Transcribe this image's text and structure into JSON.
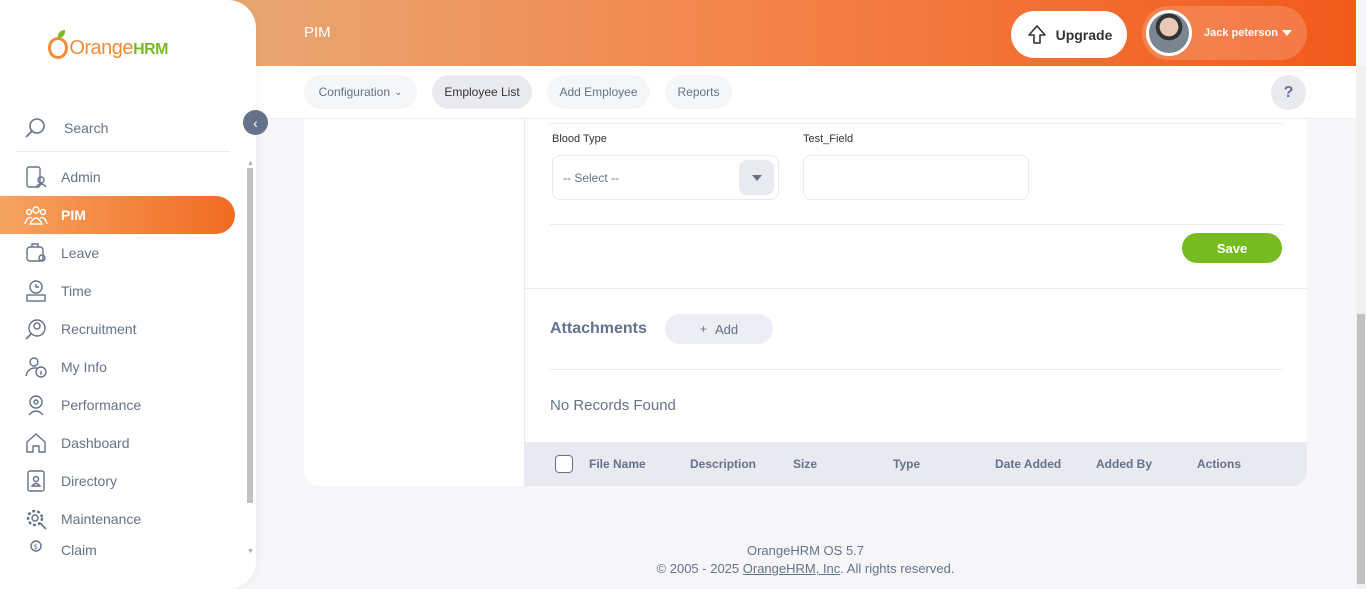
{
  "brand": {
    "name_main": "Orange",
    "name_suffix": "HRM"
  },
  "header": {
    "module_title": "PIM",
    "upgrade_label": "Upgrade",
    "user_name": "Jack peterson"
  },
  "subnav": {
    "tabs": [
      {
        "label": "Configuration",
        "has_dropdown": true
      },
      {
        "label": "Employee List",
        "active": true
      },
      {
        "label": "Add Employee"
      },
      {
        "label": "Reports"
      }
    ],
    "help_label": "?"
  },
  "sidebar": {
    "search_label": "Search",
    "items": [
      {
        "label": "Admin",
        "icon": "admin-icon"
      },
      {
        "label": "PIM",
        "icon": "pim-icon",
        "active": true
      },
      {
        "label": "Leave",
        "icon": "leave-icon"
      },
      {
        "label": "Time",
        "icon": "time-icon"
      },
      {
        "label": "Recruitment",
        "icon": "recruitment-icon"
      },
      {
        "label": "My Info",
        "icon": "my-info-icon"
      },
      {
        "label": "Performance",
        "icon": "performance-icon"
      },
      {
        "label": "Dashboard",
        "icon": "dashboard-icon"
      },
      {
        "label": "Directory",
        "icon": "directory-icon"
      },
      {
        "label": "Maintenance",
        "icon": "maintenance-icon"
      },
      {
        "label": "Claim",
        "icon": "claim-icon"
      }
    ]
  },
  "form": {
    "blood_type_label": "Blood Type",
    "blood_type_value": "-- Select --",
    "test_field_label": "Test_Field",
    "test_field_value": "",
    "save_label": "Save"
  },
  "attachments": {
    "title": "Attachments",
    "add_label": "Add",
    "empty_text": "No Records Found",
    "columns": [
      "File Name",
      "Description",
      "Size",
      "Type",
      "Date Added",
      "Added By",
      "Actions"
    ]
  },
  "footer": {
    "version": "OrangeHRM OS 5.7",
    "copyright_prefix": "© 2005 - 2025 ",
    "company_link": "OrangeHRM, Inc",
    "copyright_suffix": ". All rights reserved."
  },
  "colors": {
    "accent": "#f26b22",
    "save_green": "#76bc21",
    "text_muted": "#64728c"
  }
}
